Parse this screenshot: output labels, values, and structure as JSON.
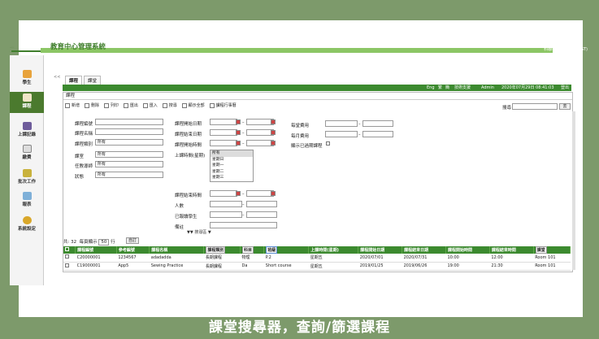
{
  "app": {
    "title": "教育中心管理系統",
    "company": "科聯科技有限公司 (IGT)"
  },
  "sidebar": {
    "collapse": "<<",
    "items": [
      {
        "label": "學生",
        "icon": "student-icon"
      },
      {
        "label": "課程",
        "icon": "course-icon",
        "active": true
      },
      {
        "label": "上課記錄",
        "icon": "attendance-icon"
      },
      {
        "label": "繳費",
        "icon": "payment-icon"
      },
      {
        "label": "批次工作",
        "icon": "batch-icon"
      },
      {
        "label": "報表",
        "icon": "report-icon"
      },
      {
        "label": "系統設定",
        "icon": "settings-icon"
      }
    ]
  },
  "tabs": [
    "課程",
    "課堂"
  ],
  "greenbar": {
    "lang_en": "Eng",
    "lang_zh1": "繁",
    "lang_zh2": "簡",
    "support": "技術支援",
    "user": "Admin",
    "datetime": "2020年07月29日 08:41:03",
    "logout": "登出"
  },
  "panel": {
    "title": "課程"
  },
  "toolbar": [
    "新增",
    "刪除",
    "列印",
    "匯出",
    "匯入",
    "搜尋",
    "顯示全部",
    "課程行事曆"
  ],
  "search": {
    "label": "搜尋",
    "button": "去"
  },
  "form": {
    "course_code": "課程編號",
    "course_name": "課程名稱",
    "course_category": "課程類別",
    "course_category_val": "所有",
    "classroom": "課室",
    "classroom_val": "所有",
    "teacher": "任教導師",
    "teacher_val": "所有",
    "status": "狀態",
    "status_val": "所有",
    "start_date": "課程開始日期",
    "end_date": "課程結束日期",
    "start_time": "課程開始時間",
    "weekday": "上課時間(星期)",
    "weekday_options": [
      "所有",
      "星期日",
      "星期一",
      "星期二",
      "星期三"
    ],
    "end_time": "課程結束時間",
    "headcount": "人數",
    "enrolled": "已報讀學生",
    "remark": "備註",
    "fee_per": "每堂費用",
    "fee_month": "每月費用",
    "show_expired": "顯示已過期課程",
    "dash": "–"
  },
  "collapse_search": "▼▼ 搜尋區 ▼",
  "list": {
    "count_label": "共: 32",
    "per_page_label": "每頁顯示",
    "per_page": "50",
    "rows_suffix": "行",
    "custom": "自訂",
    "headers": [
      "課程編號",
      "參考編號",
      "課程名稱",
      "課程類別",
      "科目",
      "班級",
      "上課時間(星期)",
      "課程開始日期",
      "課程結束日期",
      "課程開始時間",
      "課程結束時間",
      "課堂"
    ],
    "rows": [
      [
        "C20000001",
        "1234567",
        "adadadda",
        "長期課程",
        "物理",
        "P.2",
        "星期五",
        "2020/07/01",
        "2020/07/31",
        "10:00",
        "12:00",
        "Room 101"
      ],
      [
        "C19000001",
        "App5",
        "Sewing Practice",
        "長期課程",
        "Da",
        "Short course",
        "星期五",
        "2019/01/25",
        "2019/06/26",
        "19:00",
        "21:30",
        "Room 101"
      ]
    ]
  },
  "caption": "課堂搜尋器，查詢/篩選課程"
}
